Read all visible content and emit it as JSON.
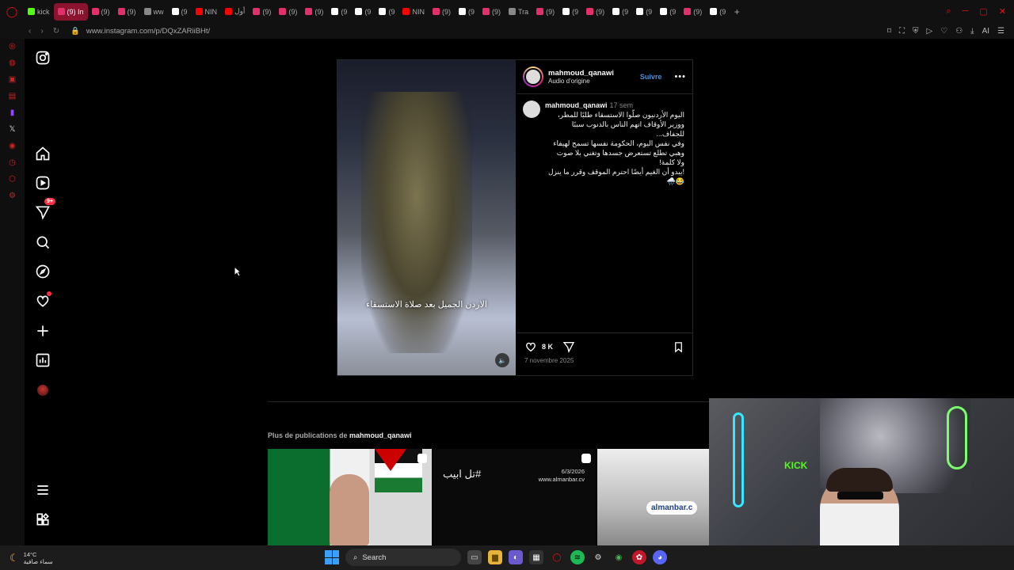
{
  "browser": {
    "tabs": [
      {
        "label": "kick",
        "color": "#53fc18"
      },
      {
        "label": "(9) In",
        "color": "#e1306c",
        "active": true
      },
      {
        "label": "(9)",
        "color": "#e1306c"
      },
      {
        "label": "(9)",
        "color": "#e1306c"
      },
      {
        "label": "ww",
        "color": "#888888"
      },
      {
        "label": "(9",
        "color": "#ffffff"
      },
      {
        "label": "NIN",
        "color": "#ff0000"
      },
      {
        "label": "أول",
        "color": "#ff0000"
      },
      {
        "label": "(9)",
        "color": "#e1306c"
      },
      {
        "label": "(9)",
        "color": "#e1306c"
      },
      {
        "label": "(9)",
        "color": "#e1306c"
      },
      {
        "label": "(9",
        "color": "#ffffff"
      },
      {
        "label": "(9",
        "color": "#ffffff"
      },
      {
        "label": "(9",
        "color": "#ffffff"
      },
      {
        "label": "NIN",
        "color": "#ff0000"
      },
      {
        "label": "(9)",
        "color": "#e1306c"
      },
      {
        "label": "(9",
        "color": "#ffffff"
      },
      {
        "label": "(9)",
        "color": "#e1306c"
      },
      {
        "label": "Tra",
        "color": "#888888"
      },
      {
        "label": "(9)",
        "color": "#e1306c"
      },
      {
        "label": "(9",
        "color": "#ffffff"
      },
      {
        "label": "(9)",
        "color": "#e1306c"
      },
      {
        "label": "(9",
        "color": "#ffffff"
      },
      {
        "label": "(9",
        "color": "#ffffff"
      },
      {
        "label": "(9",
        "color": "#ffffff"
      },
      {
        "label": "(9)",
        "color": "#e1306c"
      },
      {
        "label": "(9",
        "color": "#ffffff"
      }
    ],
    "url": "www.instagram.com/p/DQxZARiiBHt/",
    "ai_label": "AI"
  },
  "post": {
    "username": "mahmoud_qanawi",
    "audio": "Audio d'origine",
    "follow": "Suivre",
    "caption_user": "mahmoud_qanawi",
    "caption_time": "17 sem",
    "caption_lines": [
      "اليوم الأردنيون صلّوا الاستسقاء طلبًا للمطر،",
      "ووزير الأوقاف اتهم الناس بالذنوب سببًا",
      "للجفاف...",
      "وفي نفس اليوم، الحكومة نفسها تسمح لهيفاء",
      "وهبي تطلع تستعرض جسدها وتغني بلا صوت",
      "ولا كلمة!",
      "!يبدو أن الغيم أيضًا احترم الموقف وقرر ما ينزل",
      "😂🌧️"
    ],
    "video_caption": "الاردن الجميل بعد صلاة الاستسقاء",
    "likes": "8 K",
    "date": "7 novembre 2025"
  },
  "more": {
    "prefix": "Plus de publications de",
    "user": "mahmoud_qanawi",
    "thumb2_text": "#تل ابيب",
    "thumb2_date": "6/3/2026",
    "thumb2_site": "www.almanbar.cv",
    "thumb3_logo": "almanbar.c"
  },
  "webcam": {
    "kick_label": "KICK"
  },
  "taskbar": {
    "temp": "14°C",
    "weather": "سماء صافية",
    "search": "Search"
  },
  "colors": {
    "accent": "#4a90e2",
    "notif": "#ff3040",
    "kick": "#53fc18"
  }
}
